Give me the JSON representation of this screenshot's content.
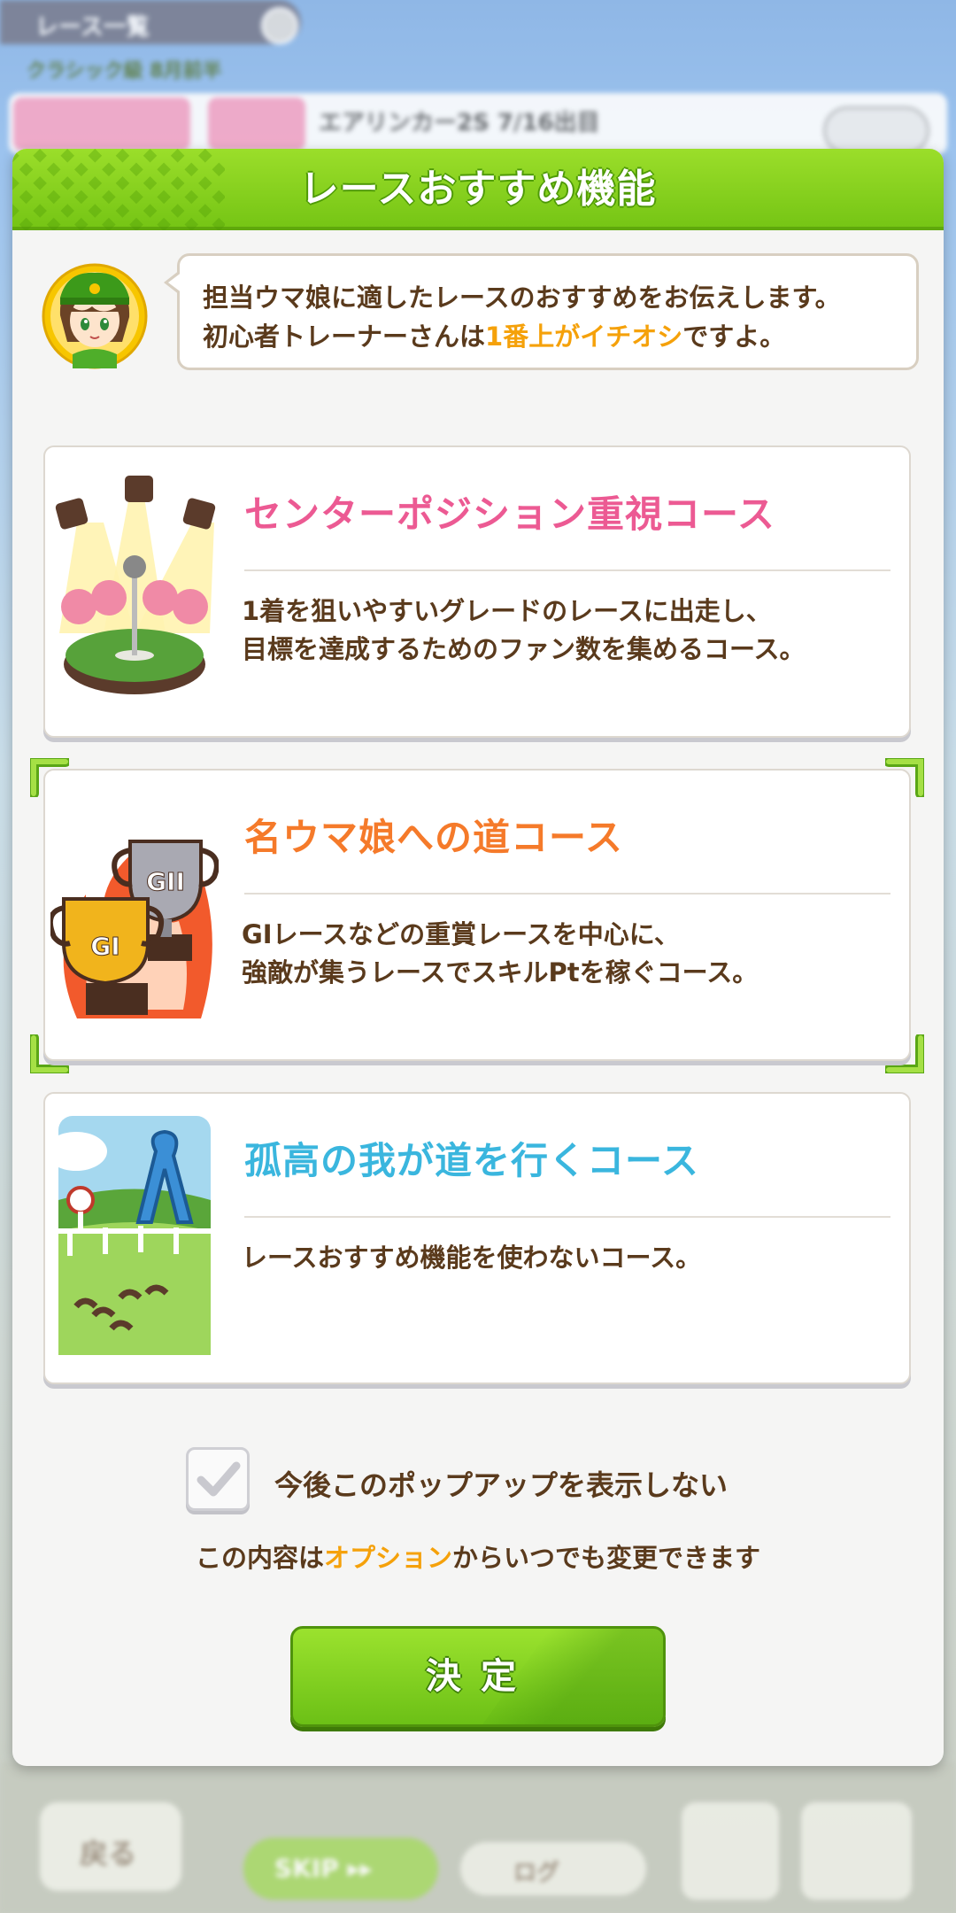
{
  "background": {
    "top_bar_label": "レース一覧",
    "subtitle": "クラシック級 8月前半",
    "race_info": "エアリンカー2S 7/16出目",
    "back_label": "戻る",
    "skip_label": "SKIP ▸▸",
    "log_label": "ログ"
  },
  "dialog": {
    "title": "レースおすすめ機能",
    "bubble": {
      "line1": "担当ウマ娘に適したレースのおすすめをお伝えします。",
      "line2_pre": "初心者トレーナーさんは",
      "line2_highlight": "1番上がイチオシ",
      "line2_post": "ですよ。"
    },
    "cards": [
      {
        "title": "センターポジション重視コース",
        "desc1": "1着を狙いやすいグレードのレースに出走し、",
        "desc2": "目標を達成するためのファン数を集めるコース。",
        "selected": false
      },
      {
        "title": "名ウマ娘への道コース",
        "desc1": "GⅠレースなどの重賞レースを中心に、",
        "desc2": "強敵が集うレースでスキルPtを稼ぐコース。",
        "selected": true
      },
      {
        "title": "孤高の我が道を行くコース",
        "desc1": "レースおすすめ機能を使わないコース。",
        "desc2": "",
        "selected": false
      }
    ],
    "checkbox_label": "今後このポップアップを表示しない",
    "checkbox_checked": true,
    "note_pre": "この内容は",
    "note_highlight": "オプション",
    "note_post": "からいつでも変更できます",
    "confirm_label": "決定"
  },
  "colors": {
    "header_green": "#8ad222",
    "text_brown": "#5a3a1c",
    "highlight_orange": "#f5a10a",
    "course1_pink": "#ec5a93",
    "course2_orange": "#f57a2a",
    "course3_blue": "#3ab6de"
  }
}
